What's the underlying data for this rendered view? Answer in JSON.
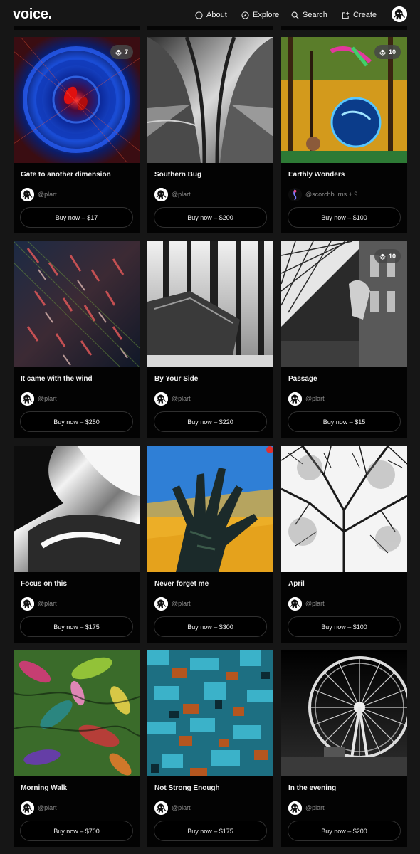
{
  "header": {
    "logo": "voice.",
    "nav": [
      {
        "label": "About",
        "icon": "info-icon"
      },
      {
        "label": "Explore",
        "icon": "compass-icon"
      },
      {
        "label": "Search",
        "icon": "search-icon"
      },
      {
        "label": "Create",
        "icon": "create-icon"
      }
    ],
    "avatar_icon": "user-avatar"
  },
  "colors": {
    "background": "#161616",
    "card": "#030303",
    "button_border": "#2f2f2f",
    "muted_text": "#8c8c8c"
  },
  "cards": [
    {
      "title": "Gate to another dimension",
      "creator": "@plart",
      "buy": "Buy now – $17",
      "editions": "7"
    },
    {
      "title": "Southern Bug",
      "creator": "@plart",
      "buy": "Buy now – $200",
      "editions": ""
    },
    {
      "title": "Earthly Wonders",
      "creator": "@scorchburns + 9",
      "buy": "Buy now – $100",
      "editions": "10"
    },
    {
      "title": "It came with the wind",
      "creator": "@plart",
      "buy": "Buy now – $250",
      "editions": ""
    },
    {
      "title": "By Your Side",
      "creator": "@plart",
      "buy": "Buy now – $220",
      "editions": ""
    },
    {
      "title": "Passage",
      "creator": "@plart",
      "buy": "Buy now – $15",
      "editions": "10"
    },
    {
      "title": "Focus on this",
      "creator": "@plart",
      "buy": "Buy now – $175",
      "editions": ""
    },
    {
      "title": "Never forget me",
      "creator": "@plart",
      "buy": "Buy now – $300",
      "editions": ""
    },
    {
      "title": "April",
      "creator": "@plart",
      "buy": "Buy now – $100",
      "editions": ""
    },
    {
      "title": "Morning Walk",
      "creator": "@plart",
      "buy": "Buy now – $700",
      "editions": ""
    },
    {
      "title": "Not Strong Enough",
      "creator": "@plart",
      "buy": "Buy now – $175",
      "editions": ""
    },
    {
      "title": "In the evening",
      "creator": "@plart",
      "buy": "Buy now – $200",
      "editions": ""
    }
  ]
}
